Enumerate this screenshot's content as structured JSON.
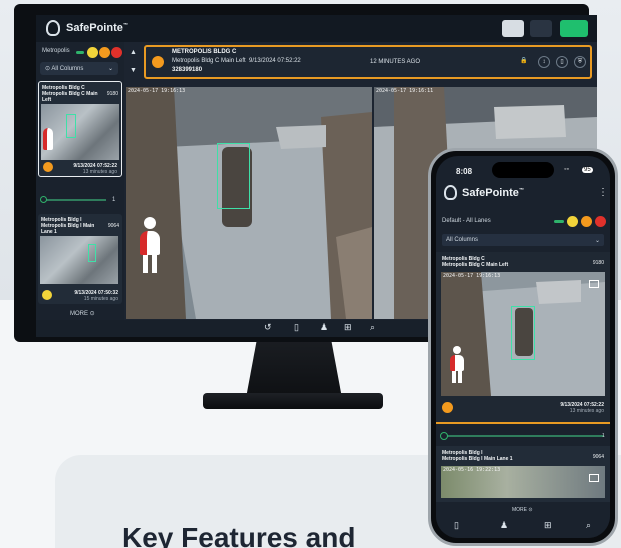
{
  "brand": {
    "name": "SafePointe",
    "tm": "™"
  },
  "desktop": {
    "sidebar": {
      "site": "Metropolis",
      "columns_select": "All Columns",
      "status_colors": [
        "#2fb36b",
        "#f2d43a",
        "#f39a1e",
        "#e0312b"
      ],
      "cards": [
        {
          "title": "Metropolis Bldg C Metropolis Bldg C Main Left",
          "id": "9180",
          "datetime": "9/13/2024 07:52:22",
          "ago": "13 minutes ago",
          "status_color": "#f39a1e"
        },
        {
          "title": "Metropolis Bldg I Metropolis Bldg I Main Lane 1",
          "id": "9064",
          "datetime": "9/13/2024 07:50:32",
          "ago": "15 minutes ago",
          "status_color": "#f2d43a"
        }
      ],
      "slider_value": "1",
      "more_label": "MORE"
    },
    "header": {
      "title": "METROPOLIS BLDG C",
      "subtitle": "Metropolis Bldg C Main Left",
      "datetime": "9/13/2024 07:52:22",
      "record_id": "328399180",
      "ago": "12 MINUTES AGO"
    },
    "cameras": [
      {
        "timestamp": "2024-05-17 19:16:13"
      },
      {
        "timestamp": "2024-05-17 19:16:11"
      }
    ],
    "bottom_nav": [
      "↺",
      "🔖",
      "🚶",
      "⊞",
      "🔍"
    ]
  },
  "mobile": {
    "time": "8:08",
    "battery": "95",
    "lanes_label": "Default - All Lanes",
    "columns_select": "All Columns",
    "card1": {
      "title_line1": "Metropolis Bldg C",
      "title_line2": "Metropolis Bldg C Main Left",
      "id": "9180",
      "timestamp": "2024-05-17 19:16:13",
      "datetime": "9/13/2024 07:52:22",
      "ago": "13 minutes ago"
    },
    "slider_value": "1",
    "card2": {
      "title_line1": "Metropolis Bldg I",
      "title_line2": "Metropolis Bldg I Main Lane 1",
      "id": "9064",
      "timestamp": "2024-05-16 19:22:13"
    },
    "more_label": "MORE"
  },
  "page": {
    "heading": "Key Features and"
  }
}
